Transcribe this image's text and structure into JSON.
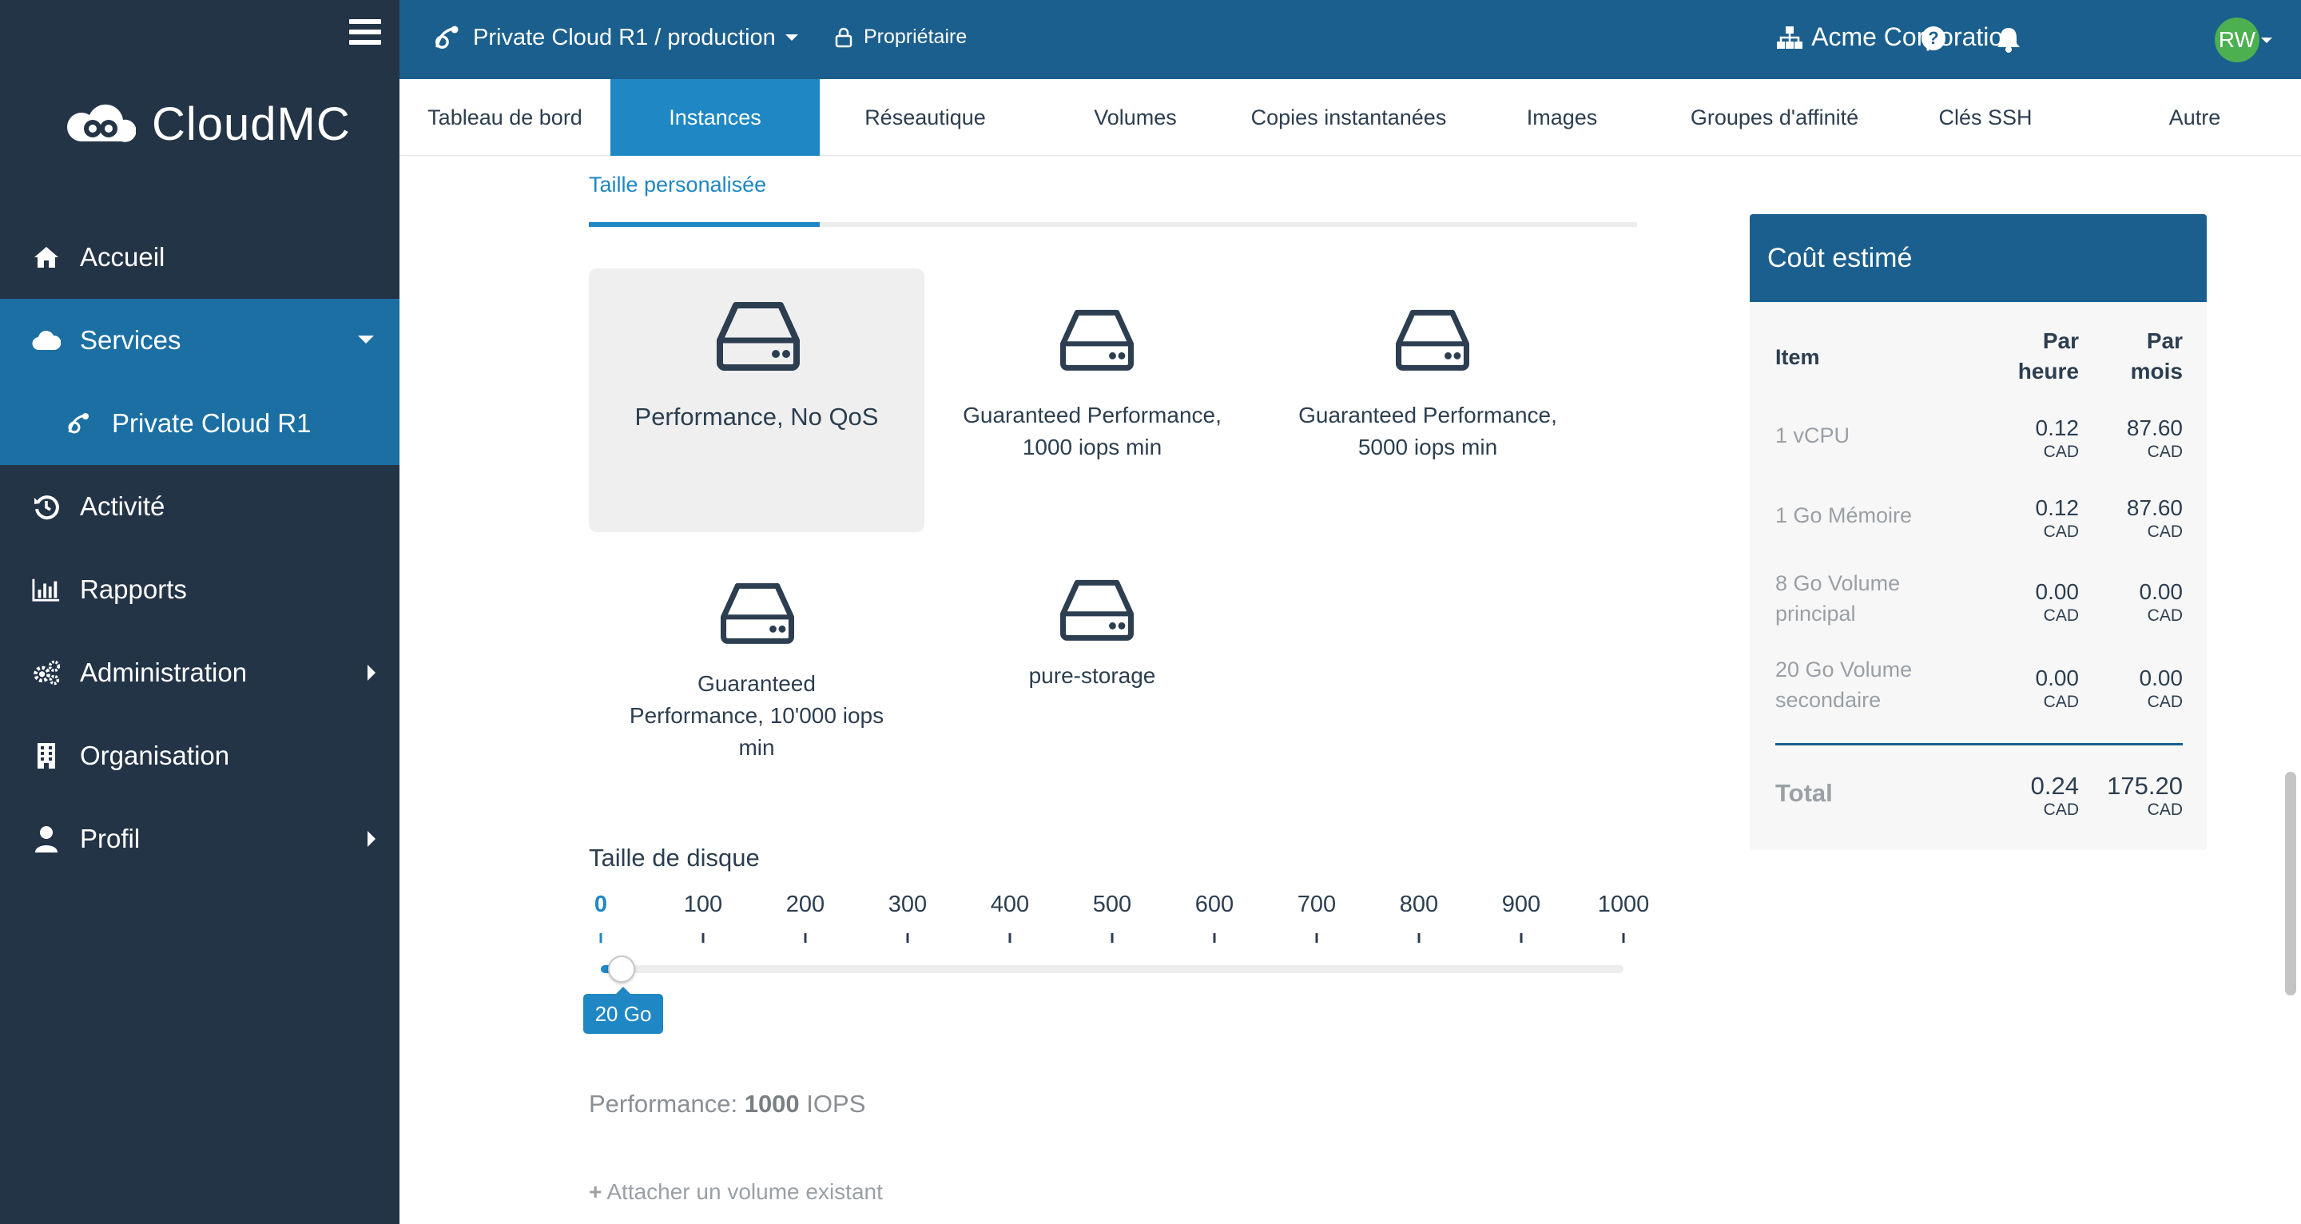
{
  "app": {
    "logo_text": "CloudMC"
  },
  "sidebar": {
    "items": [
      {
        "label": "Accueil",
        "icon": "home-icon"
      },
      {
        "label": "Services",
        "icon": "cloud-icon"
      },
      {
        "label": "Private Cloud R1",
        "icon": "vmware-icon"
      },
      {
        "label": "Activité",
        "icon": "history-icon"
      },
      {
        "label": "Rapports",
        "icon": "bar-chart-icon"
      },
      {
        "label": "Administration",
        "icon": "gears-icon"
      },
      {
        "label": "Organisation",
        "icon": "building-icon"
      },
      {
        "label": "Profil",
        "icon": "user-icon"
      }
    ]
  },
  "topbar": {
    "breadcrumb": "Private Cloud R1 / production",
    "owner": "Propriétaire",
    "organization": "Acme Corporation",
    "help_glyph": "?",
    "avatar_initials": "RW"
  },
  "tabs": [
    {
      "label": "Tableau de bord"
    },
    {
      "label": "Instances"
    },
    {
      "label": "Réseautique"
    },
    {
      "label": "Volumes"
    },
    {
      "label": "Copies instantanées"
    },
    {
      "label": "Images"
    },
    {
      "label": "Groupes d'affinité"
    },
    {
      "label": "Clés SSH"
    },
    {
      "label": "Autre"
    }
  ],
  "content": {
    "subtab": "Taille personalisée",
    "storage_options": [
      {
        "label": "Performance, No QoS",
        "selected": true
      },
      {
        "label": "Guaranteed Performance, 1000 iops min",
        "selected": false
      },
      {
        "label": "Guaranteed Performance, 5000 iops min",
        "selected": false
      },
      {
        "label": "Guaranteed Performance, 10'000 iops min",
        "selected": false
      },
      {
        "label": "pure-storage",
        "selected": false
      }
    ],
    "disk_size": {
      "title": "Taille de disque",
      "ticks": [
        "0",
        "100",
        "200",
        "300",
        "400",
        "500",
        "600",
        "700",
        "800",
        "900",
        "1000"
      ],
      "min": 0,
      "max": 1000,
      "value": 20,
      "value_label": "20 Go"
    },
    "performance": {
      "prefix": "Performance:",
      "value": "1000",
      "unit": "IOPS"
    },
    "attach_label": "Attacher un volume existant"
  },
  "cost": {
    "title": "Coût estimé",
    "headers": {
      "item": "Item",
      "hour_1": "Par",
      "hour_2": "heure",
      "month_1": "Par",
      "month_2": "mois"
    },
    "rows": [
      {
        "item": "1 vCPU",
        "hour": "0.12",
        "month": "87.60"
      },
      {
        "item": "1 Go Mémoire",
        "hour": "0.12",
        "month": "87.60"
      },
      {
        "item": "8 Go Volume principal",
        "hour": "0.00",
        "month": "0.00"
      },
      {
        "item": "20 Go Volume secondaire",
        "hour": "0.00",
        "month": "0.00"
      }
    ],
    "currency": "CAD",
    "total": {
      "label": "Total",
      "hour": "0.24",
      "month": "175.20"
    }
  },
  "colors": {
    "sidebar": "#243447",
    "topbar": "#1b5f8e",
    "accent": "#1f87c4",
    "avatar": "#4caf50"
  }
}
